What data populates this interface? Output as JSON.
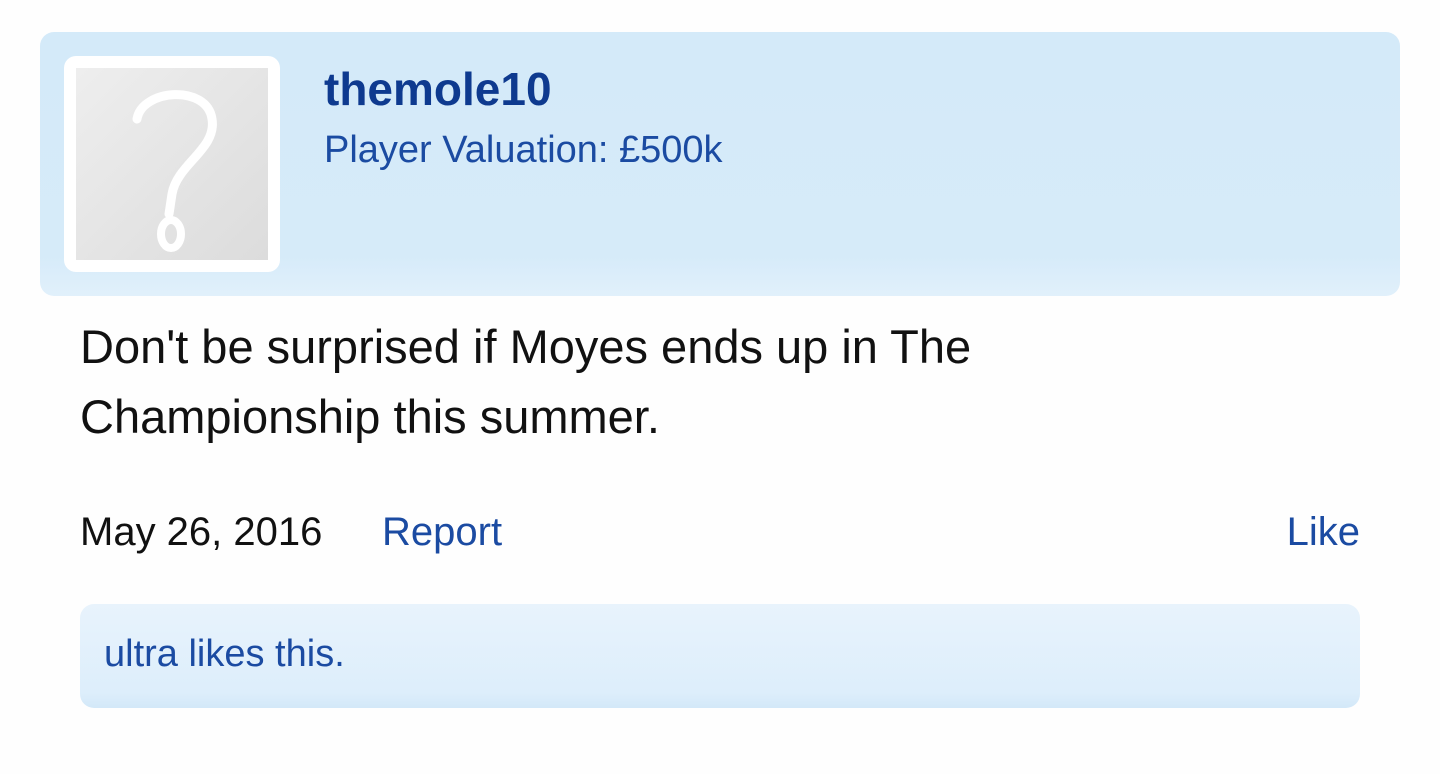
{
  "post": {
    "author": {
      "username": "themole10",
      "user_title": "Player Valuation: £500k",
      "avatar_icon": "question-mark-avatar-icon"
    },
    "message": "Don't be surprised if Moyes ends up in The Championship this summer.",
    "date": "May 26, 2016",
    "actions": {
      "report_label": "Report",
      "like_label": "Like"
    },
    "likes_summary": "ultra likes this."
  },
  "colors": {
    "header_bg": "#d6ebf9",
    "link": "#1b4ba2",
    "username": "#0e3a8f",
    "text": "#111111"
  }
}
